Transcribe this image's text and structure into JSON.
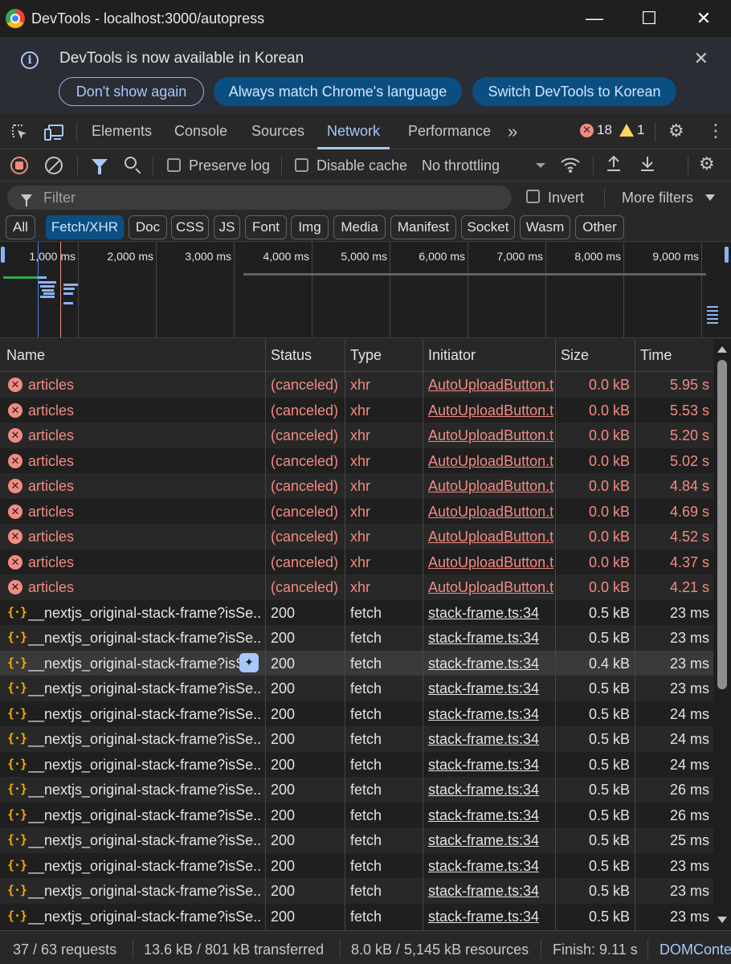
{
  "window": {
    "title": "DevTools - localhost:3000/autopress",
    "minimize": "—",
    "maximize": "☐",
    "close": "✕"
  },
  "infobar": {
    "message": "DevTools is now available in Korean",
    "buttons": [
      "Don't show again",
      "Always match Chrome's language",
      "Switch DevTools to Korean"
    ],
    "close": "✕"
  },
  "tabs": {
    "items": [
      "Elements",
      "Console",
      "Sources",
      "Network",
      "Performance"
    ],
    "active": "Network",
    "more": "»",
    "errors": "18",
    "warnings": "1"
  },
  "toolbar": {
    "preserve_log": "Preserve log",
    "disable_cache": "Disable cache",
    "throttling": "No throttling"
  },
  "filter": {
    "placeholder": "Filter",
    "invert": "Invert",
    "more_filters": "More filters"
  },
  "chips": [
    "All",
    "Fetch/XHR",
    "Doc",
    "CSS",
    "JS",
    "Font",
    "Img",
    "Media",
    "Manifest",
    "Socket",
    "Wasm",
    "Other"
  ],
  "active_chip": "Fetch/XHR",
  "overview": {
    "ticks": [
      "1,000 ms",
      "2,000 ms",
      "3,000 ms",
      "4,000 ms",
      "5,000 ms",
      "6,000 ms",
      "7,000 ms",
      "8,000 ms",
      "9,000 ms"
    ]
  },
  "table": {
    "headers": [
      "Name",
      "Status",
      "Type",
      "Initiator",
      "Size",
      "Time"
    ],
    "rows": [
      {
        "name": "articles",
        "status": "(canceled)",
        "type": "xhr",
        "initiator": "AutoUploadButton.t",
        "size": "0.0 kB",
        "time": "5.95 s",
        "error": true
      },
      {
        "name": "articles",
        "status": "(canceled)",
        "type": "xhr",
        "initiator": "AutoUploadButton.t",
        "size": "0.0 kB",
        "time": "5.53 s",
        "error": true
      },
      {
        "name": "articles",
        "status": "(canceled)",
        "type": "xhr",
        "initiator": "AutoUploadButton.t",
        "size": "0.0 kB",
        "time": "5.20 s",
        "error": true
      },
      {
        "name": "articles",
        "status": "(canceled)",
        "type": "xhr",
        "initiator": "AutoUploadButton.t",
        "size": "0.0 kB",
        "time": "5.02 s",
        "error": true
      },
      {
        "name": "articles",
        "status": "(canceled)",
        "type": "xhr",
        "initiator": "AutoUploadButton.t",
        "size": "0.0 kB",
        "time": "4.84 s",
        "error": true
      },
      {
        "name": "articles",
        "status": "(canceled)",
        "type": "xhr",
        "initiator": "AutoUploadButton.t",
        "size": "0.0 kB",
        "time": "4.69 s",
        "error": true
      },
      {
        "name": "articles",
        "status": "(canceled)",
        "type": "xhr",
        "initiator": "AutoUploadButton.t",
        "size": "0.0 kB",
        "time": "4.52 s",
        "error": true
      },
      {
        "name": "articles",
        "status": "(canceled)",
        "type": "xhr",
        "initiator": "AutoUploadButton.t",
        "size": "0.0 kB",
        "time": "4.37 s",
        "error": true
      },
      {
        "name": "articles",
        "status": "(canceled)",
        "type": "xhr",
        "initiator": "AutoUploadButton.t",
        "size": "0.0 kB",
        "time": "4.21 s",
        "error": true
      },
      {
        "name": "__nextjs_original-stack-frame?isSe...",
        "status": "200",
        "type": "fetch",
        "initiator": "stack-frame.ts:34",
        "size": "0.5 kB",
        "time": "23 ms",
        "error": false
      },
      {
        "name": "__nextjs_original-stack-frame?isSe...",
        "status": "200",
        "type": "fetch",
        "initiator": "stack-frame.ts:34",
        "size": "0.5 kB",
        "time": "23 ms",
        "error": false
      },
      {
        "name": "__nextjs_original-stack-frame?isS",
        "status": "200",
        "type": "fetch",
        "initiator": "stack-frame.ts:34",
        "size": "0.4 kB",
        "time": "23 ms",
        "error": false,
        "hover": true
      },
      {
        "name": "__nextjs_original-stack-frame?isSe...",
        "status": "200",
        "type": "fetch",
        "initiator": "stack-frame.ts:34",
        "size": "0.5 kB",
        "time": "23 ms",
        "error": false
      },
      {
        "name": "__nextjs_original-stack-frame?isSe...",
        "status": "200",
        "type": "fetch",
        "initiator": "stack-frame.ts:34",
        "size": "0.5 kB",
        "time": "24 ms",
        "error": false
      },
      {
        "name": "__nextjs_original-stack-frame?isSe...",
        "status": "200",
        "type": "fetch",
        "initiator": "stack-frame.ts:34",
        "size": "0.5 kB",
        "time": "24 ms",
        "error": false
      },
      {
        "name": "__nextjs_original-stack-frame?isSe...",
        "status": "200",
        "type": "fetch",
        "initiator": "stack-frame.ts:34",
        "size": "0.5 kB",
        "time": "24 ms",
        "error": false
      },
      {
        "name": "__nextjs_original-stack-frame?isSe...",
        "status": "200",
        "type": "fetch",
        "initiator": "stack-frame.ts:34",
        "size": "0.5 kB",
        "time": "26 ms",
        "error": false
      },
      {
        "name": "__nextjs_original-stack-frame?isSe...",
        "status": "200",
        "type": "fetch",
        "initiator": "stack-frame.ts:34",
        "size": "0.5 kB",
        "time": "26 ms",
        "error": false
      },
      {
        "name": "__nextjs_original-stack-frame?isSe...",
        "status": "200",
        "type": "fetch",
        "initiator": "stack-frame.ts:34",
        "size": "0.5 kB",
        "time": "25 ms",
        "error": false
      },
      {
        "name": "__nextjs_original-stack-frame?isSe...",
        "status": "200",
        "type": "fetch",
        "initiator": "stack-frame.ts:34",
        "size": "0.5 kB",
        "time": "23 ms",
        "error": false
      },
      {
        "name": "__nextjs_original-stack-frame?isSe...",
        "status": "200",
        "type": "fetch",
        "initiator": "stack-frame.ts:34",
        "size": "0.5 kB",
        "time": "23 ms",
        "error": false
      },
      {
        "name": "__nextjs_original-stack-frame?isSe...",
        "status": "200",
        "type": "fetch",
        "initiator": "stack-frame.ts:34",
        "size": "0.5 kB",
        "time": "23 ms",
        "error": false
      }
    ]
  },
  "status": {
    "requests": "37 / 63 requests",
    "transferred": "13.6 kB / 801 kB transferred",
    "resources": "8.0 kB / 5,145 kB resources",
    "finish": "Finish: 9.11 s",
    "domcontent": "DOMConte"
  },
  "colors": {
    "accent": "#a8c7fa",
    "error": "#f28b82",
    "warning": "#fdd663",
    "chip_active": "#0b4f82"
  }
}
